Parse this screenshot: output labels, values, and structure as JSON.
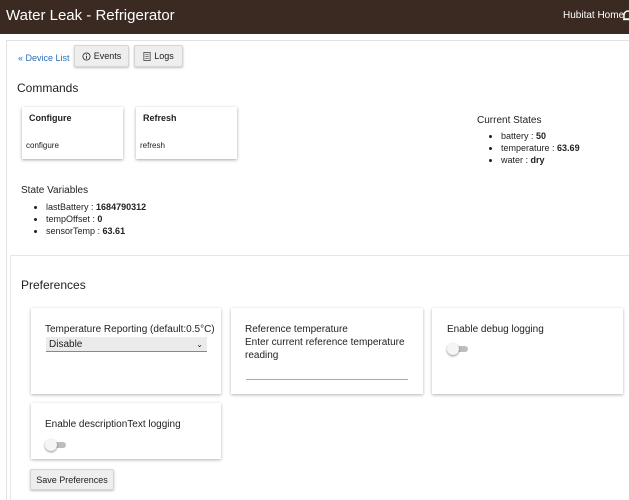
{
  "header": {
    "title": "Water Leak - Refrigerator",
    "hub_name": "Hubitat Home",
    "notification_icon": "bell-icon"
  },
  "toolbar": {
    "device_list_link": "« Device List",
    "events_label": "Events",
    "events_icon": "info-icon",
    "logs_label": "Logs",
    "logs_icon": "document-icon"
  },
  "commands": {
    "heading": "Commands",
    "items": [
      {
        "title": "Configure",
        "command": "configure"
      },
      {
        "title": "Refresh",
        "command": "refresh"
      }
    ]
  },
  "current_states": {
    "heading": "Current States",
    "items": [
      {
        "name": "battery",
        "value": "50"
      },
      {
        "name": "temperature",
        "value": "63.69"
      },
      {
        "name": "water",
        "value": "dry"
      }
    ]
  },
  "state_variables": {
    "heading": "State Variables",
    "items": [
      {
        "name": "lastBattery",
        "value": "1684790312"
      },
      {
        "name": "tempOffset",
        "value": "0"
      },
      {
        "name": "sensorTemp",
        "value": "63.61"
      }
    ]
  },
  "preferences": {
    "heading": "Preferences",
    "temp_reporting": {
      "label": "Temperature Reporting (default:0.5°C)",
      "selected": "Disable"
    },
    "reference_temp": {
      "label": "Reference temperature",
      "description": "Enter current reference temperature reading",
      "value": ""
    },
    "debug_logging": {
      "label": "Enable debug logging",
      "enabled": false
    },
    "desc_logging": {
      "label": "Enable descriptionText logging",
      "enabled": false
    },
    "save_label": "Save Preferences"
  },
  "colors": {
    "header_bg": "#3a2a22",
    "link": "#2a6ebb"
  }
}
